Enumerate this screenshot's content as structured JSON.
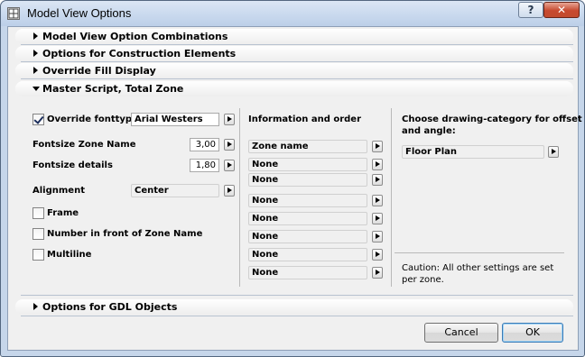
{
  "window": {
    "title": "Model View Options",
    "help_glyph": "?",
    "close_glyph": "✕"
  },
  "sections": {
    "combinations": "Model View Option Combinations",
    "construction": "Options for Construction Elements",
    "override_fill": "Override Fill Display",
    "master_script": "Master Script, Total Zone",
    "gdl": "Options for GDL Objects"
  },
  "left": {
    "override_fonttype": {
      "label": "Override fonttype",
      "checked": true,
      "value": "Arial Westers"
    },
    "fontsize_zone_name": {
      "label": "Fontsize Zone Name",
      "value": "3,00"
    },
    "fontsize_details": {
      "label": "Fontsize details",
      "value": "1,80"
    },
    "alignment": {
      "label": "Alignment",
      "value": "Center"
    },
    "frame": {
      "label": "Frame",
      "checked": false
    },
    "number_in_front": {
      "label": "Number in front of Zone Name",
      "checked": false
    },
    "multiline": {
      "label": "Multiline",
      "checked": false
    }
  },
  "middle": {
    "header": "Information and order",
    "rows": [
      "Zone name",
      "None",
      "None",
      "None",
      "None",
      "None",
      "None",
      "None"
    ]
  },
  "right": {
    "header_line1": "Choose drawing-category for offset",
    "header_line2": "and angle:",
    "category": "Floor Plan",
    "caution_line1": "Caution: All other settings are set",
    "caution_line2": "per zone."
  },
  "buttons": {
    "cancel": "Cancel",
    "ok": "OK"
  },
  "colors": {
    "titlebar": "#c9d9ee",
    "close": "#c7492f",
    "client": "#f0f0f0"
  }
}
